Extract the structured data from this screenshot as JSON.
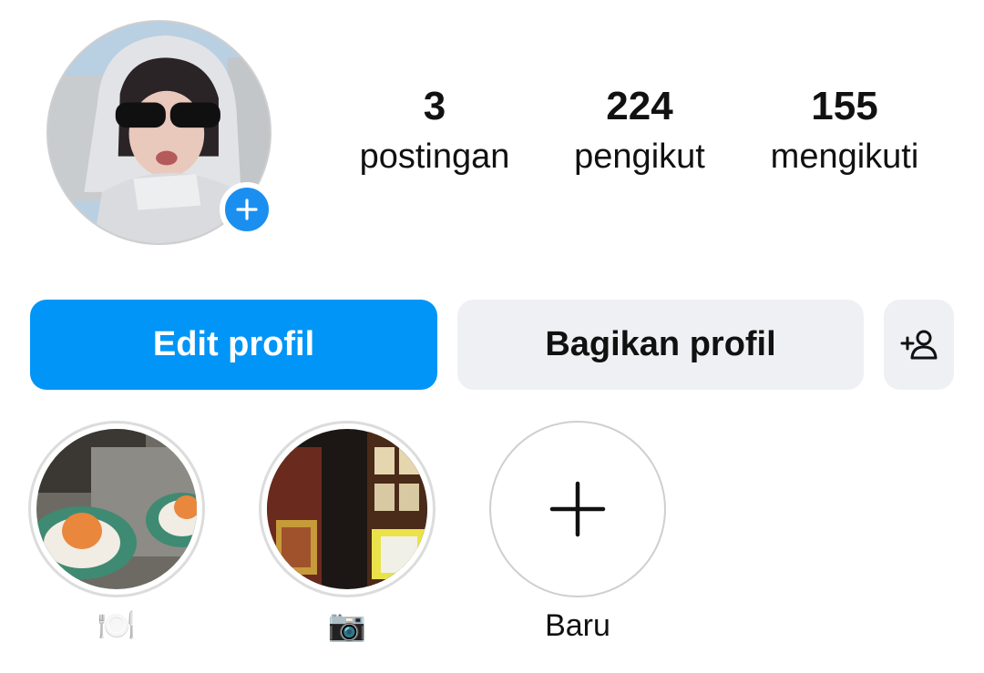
{
  "profile": {
    "avatar_icon": "profile-photo",
    "add_story_icon": "plus-icon",
    "accent_color": "#0195f7"
  },
  "stats": {
    "posts": {
      "value": "3",
      "label": "postingan"
    },
    "followers": {
      "value": "224",
      "label": "pengikut"
    },
    "following": {
      "value": "155",
      "label": "mengikuti"
    }
  },
  "actions": {
    "edit_label": "Edit profil",
    "share_label": "Bagikan profil",
    "discover_icon": "add-person-icon"
  },
  "highlights": [
    {
      "label": "🍽️",
      "icon": "dessert-photo"
    },
    {
      "label": "📷",
      "icon": "shop-photo"
    },
    {
      "label": "Baru",
      "icon": "plus-icon"
    }
  ]
}
